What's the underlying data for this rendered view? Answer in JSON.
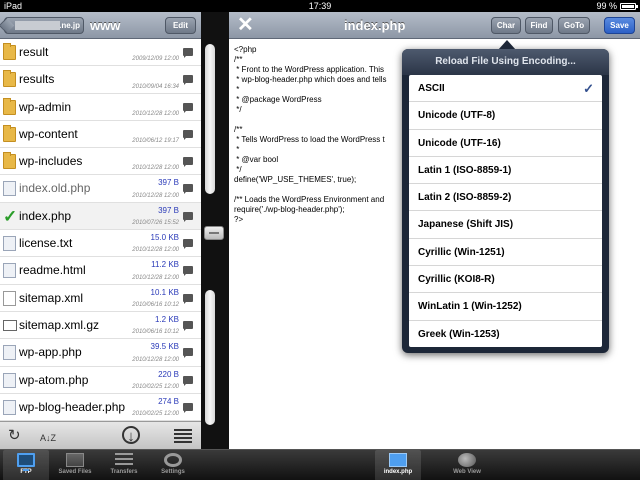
{
  "status_bar": {
    "device": "iPad",
    "time": "17:39",
    "battery": "99 %",
    "battery_level": 0.99
  },
  "left_nav": {
    "host_suffix": ".ne.jp",
    "title": "www",
    "edit_label": "Edit"
  },
  "files": [
    {
      "name": "result",
      "type": "folder",
      "size": "",
      "date": "2009/12/09 12:00"
    },
    {
      "name": "results",
      "type": "folder",
      "size": "",
      "date": "2010/09/04 16:34"
    },
    {
      "name": "wp-admin",
      "type": "folder",
      "size": "",
      "date": "2010/12/28 12:00"
    },
    {
      "name": "wp-content",
      "type": "folder",
      "size": "",
      "date": "2010/06/12 19:17"
    },
    {
      "name": "wp-includes",
      "type": "folder",
      "size": "",
      "date": "2010/12/28 12:00"
    },
    {
      "name": "index.old.php",
      "type": "file",
      "size": "397 B",
      "date": "2010/12/28 12:00"
    },
    {
      "name": "index.php",
      "type": "selected",
      "size": "397 B",
      "date": "2010/07/26 15:52"
    },
    {
      "name": "license.txt",
      "type": "file",
      "size": "15.0 KB",
      "date": "2010/12/28 12:00"
    },
    {
      "name": "readme.html",
      "type": "file",
      "size": "11.2 KB",
      "date": "2010/12/28 12:00"
    },
    {
      "name": "sitemap.xml",
      "type": "white",
      "size": "10.1 KB",
      "date": "2010/06/16 10:12"
    },
    {
      "name": "sitemap.xml.gz",
      "type": "gz",
      "size": "1.2 KB",
      "date": "2010/06/16 10:12"
    },
    {
      "name": "wp-app.php",
      "type": "file",
      "size": "39.5 KB",
      "date": "2010/12/28 12:00"
    },
    {
      "name": "wp-atom.php",
      "type": "file",
      "size": "220 B",
      "date": "2010/02/25 12:00"
    },
    {
      "name": "wp-blog-header.php",
      "type": "file",
      "size": "274 B",
      "date": "2010/02/25 12:00"
    }
  ],
  "left_toolbar": {
    "refresh": "↻",
    "sort": "A↓Z",
    "download": "↓"
  },
  "right_nav": {
    "close": "✕",
    "title": "index.php",
    "char": "Char",
    "find": "Find",
    "goto": "GoTo",
    "save": "Save"
  },
  "code_lines": [
    "<?php",
    "/**",
    " * Front to the WordPress application. This",
    " * wp-blog-header.php which does and tells",
    " *",
    " * @package WordPress",
    " */",
    "",
    "/**",
    " * Tells WordPress to load the WordPress t",
    " *",
    " * @var bool",
    " */",
    "define('WP_USE_THEMES', true);",
    "",
    "/** Loads the WordPress Environment and",
    "require('./wp-blog-header.php');",
    "?>"
  ],
  "encoding_popover": {
    "title": "Reload File Using Encoding...",
    "checkmark": "✓",
    "options": [
      {
        "label": "ASCII",
        "selected": true
      },
      {
        "label": "Unicode (UTF-8)",
        "selected": false
      },
      {
        "label": "Unicode (UTF-16)",
        "selected": false
      },
      {
        "label": "Latin 1 (ISO-8859-1)",
        "selected": false
      },
      {
        "label": "Latin 2 (ISO-8859-2)",
        "selected": false
      },
      {
        "label": "Japanese (Shift JIS)",
        "selected": false
      },
      {
        "label": "Cyrillic (Win-1251)",
        "selected": false
      },
      {
        "label": "Cyrillic (KOI8-R)",
        "selected": false
      },
      {
        "label": "WinLatin 1 (Win-1252)",
        "selected": false
      },
      {
        "label": "Greek (Win-1253)",
        "selected": false
      }
    ]
  },
  "tabbar": {
    "left_tabs": [
      {
        "label": "FTP",
        "icon": "monitor-icon",
        "active": true
      },
      {
        "label": "Saved Files",
        "icon": "saved-files-icon",
        "active": false
      },
      {
        "label": "Transfers",
        "icon": "transfers-icon",
        "active": false
      },
      {
        "label": "Settings",
        "icon": "gear-icon",
        "active": false
      }
    ],
    "right_tabs": [
      {
        "label": "index.php",
        "icon": "file-icon",
        "active": true
      },
      {
        "label": "Web View",
        "icon": "globe-icon",
        "active": false
      }
    ]
  }
}
